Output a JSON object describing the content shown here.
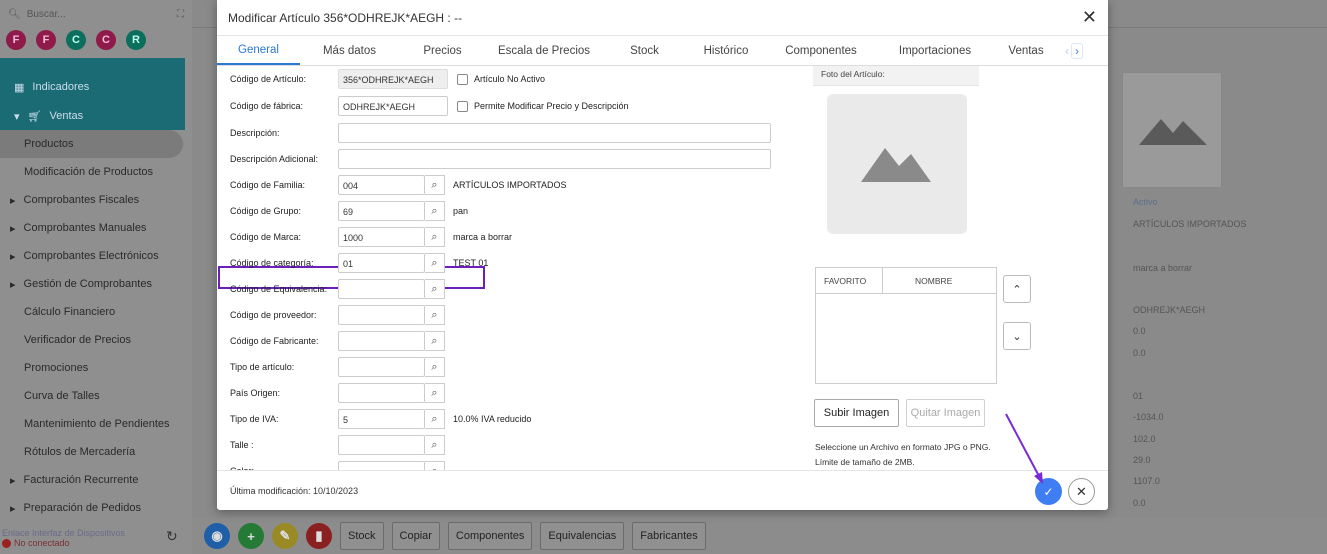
{
  "sidebar": {
    "search_placeholder": "Buscar...",
    "circles": [
      "F",
      "F",
      "C",
      "C",
      "R"
    ],
    "indicadores": "Indicadores",
    "ventas": "Ventas",
    "items": [
      {
        "label": "Productos",
        "active": true,
        "expandable": false
      },
      {
        "label": "Modificación de Productos",
        "expandable": false
      },
      {
        "label": "Comprobantes Fiscales",
        "expandable": true
      },
      {
        "label": "Comprobantes Manuales",
        "expandable": true
      },
      {
        "label": "Comprobantes Electrónicos",
        "expandable": true
      },
      {
        "label": "Gestión de Comprobantes",
        "expandable": true
      },
      {
        "label": "Cálculo Financiero",
        "expandable": false
      },
      {
        "label": "Verificador de Precios",
        "expandable": false
      },
      {
        "label": "Promociones",
        "expandable": false
      },
      {
        "label": "Curva de Talles",
        "expandable": false
      },
      {
        "label": "Mantenimiento de Pendientes",
        "expandable": false
      },
      {
        "label": "Rótulos de Mercadería",
        "expandable": false
      },
      {
        "label": "Facturación Recurrente",
        "expandable": true
      },
      {
        "label": "Preparación de Pedidos",
        "expandable": true
      }
    ],
    "footer_link": "Enlace Interfaz de Dispositivos",
    "footer_status": "No conectado"
  },
  "background_values": {
    "status": "Activo",
    "family": "ARTÍCULOS IMPORTADOS",
    "brand": "marca a borrar",
    "factory_code": "ODHREJK*AEGH",
    "v1": "0.0",
    "v2": "0.0",
    "v3": "01",
    "v4": "-1034.0",
    "v5": "102.0",
    "v6": "29.0",
    "v7": "1107.0",
    "v8": "0.0"
  },
  "bottom_bar": {
    "buttons": [
      "Stock",
      "Copiar",
      "Componentes",
      "Equivalencias",
      "Fabricantes"
    ]
  },
  "modal": {
    "title": "Modificar Artículo 356*ODHREJK*AEGH : --",
    "tabs": [
      "General",
      "Más datos",
      "Precios",
      "Escala de Precios",
      "Stock",
      "Histórico",
      "Componentes",
      "Importaciones",
      "Ventas"
    ],
    "active_tab": "General",
    "fields": {
      "codigo_articulo": {
        "label": "Código de Artículo:",
        "value": "356*ODHREJK*AEGH"
      },
      "no_activo": "Artículo No Activo",
      "codigo_fabrica": {
        "label": "Código de fábrica:",
        "value": "ODHREJK*AEGH"
      },
      "permite_modificar": "Permite Modificar Precio y Descripción",
      "descripcion": {
        "label": "Descripción:",
        "value": ""
      },
      "descripcion_adicional": {
        "label": "Descripción Adicional:",
        "value": ""
      },
      "familia": {
        "label": "Código de Familia:",
        "value": "004",
        "desc": "ARTÍCULOS IMPORTADOS"
      },
      "grupo": {
        "label": "Código de Grupo:",
        "value": "69",
        "desc": "pan"
      },
      "marca": {
        "label": "Código de Marca:",
        "value": "1000",
        "desc": "marca a borrar"
      },
      "categoria": {
        "label": "Código de categoría:",
        "value": "01",
        "desc": "TEST 01"
      },
      "equivalencia": {
        "label": "Código de Equivalencia:",
        "value": ""
      },
      "proveedor": {
        "label": "Código de proveedor:",
        "value": ""
      },
      "fabricante": {
        "label": "Código de Fabricante:",
        "value": ""
      },
      "tipo_articulo": {
        "label": "Tipo de artículo:",
        "value": ""
      },
      "pais_origen": {
        "label": "País Origen:",
        "value": ""
      },
      "tipo_iva": {
        "label": "Tipo de IVA:",
        "value": "5",
        "desc": "10.0% IVA reducido"
      },
      "talle": {
        "label": "Talle :",
        "value": ""
      },
      "color": {
        "label": "Color:",
        "value": ""
      }
    },
    "photo": {
      "title": "Foto del Artículo:",
      "fav_col": "FAVORITO",
      "name_col": "NOMBRE",
      "upload": "Subir Imagen",
      "remove": "Quitar Imagen",
      "help_line1": "Seleccione un Archivo en formato JPG o PNG.",
      "help_line2": "Límite de tamaño de 2MB."
    },
    "footer": "Última modificación: 10/10/2023"
  },
  "colors": {
    "accent": "#2a78d2",
    "highlight": "#6b1fbf",
    "ok_button": "#3f7ef2"
  }
}
